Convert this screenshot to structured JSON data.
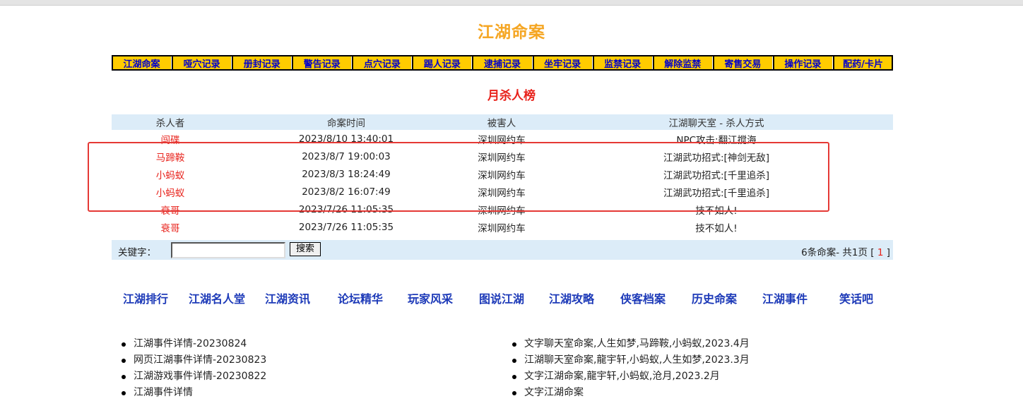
{
  "page": {
    "title": "江湖命案"
  },
  "nav": {
    "items": [
      "江湖命案",
      "哑穴记录",
      "册封记录",
      "警告记录",
      "点穴记录",
      "踢人记录",
      "逮捕记录",
      "坐牢记录",
      "监禁记录",
      "解除监禁",
      "寄售交易",
      "操作记录",
      "配药/卡片"
    ]
  },
  "section": {
    "title": "月杀人榜"
  },
  "table": {
    "headers": [
      "杀人者",
      "命案时间",
      "被害人",
      "江湖聊天室 - 杀人方式"
    ],
    "rows": [
      [
        "闯碟",
        "2023/8/10 13:40:01",
        "深圳网约车",
        "NPC攻击:翻江搅海"
      ],
      [
        "马蹄鞍",
        "2023/8/7 19:00:03",
        "深圳网约车",
        "江湖武功招式:[神剑无敌]"
      ],
      [
        "小蚂蚁",
        "2023/8/3 18:24:49",
        "深圳网约车",
        "江湖武功招式:[千里追杀]"
      ],
      [
        "小蚂蚁",
        "2023/8/2 16:07:49",
        "深圳网约车",
        "江湖武功招式:[千里追杀]"
      ],
      [
        "衰哥",
        "2023/7/26 11:05:35",
        "深圳网约车",
        "技不如人!"
      ],
      [
        "衰哥",
        "2023/7/26 11:05:35",
        "深圳网约车",
        "技不如人!"
      ]
    ]
  },
  "search": {
    "label": "关键字：",
    "value": "",
    "button_label": "搜索",
    "count_text": "6条命案- 共1页 [ ",
    "current_page": "1",
    "close_bracket": " ]"
  },
  "links": [
    "江湖排行",
    "江湖名人堂",
    "江湖资讯",
    "论坛精华",
    "玩家风采",
    "图说江湖",
    "江湖攻略",
    "侠客档案",
    "历史命案",
    "江湖事件",
    "笑话吧"
  ],
  "news_left": [
    "江湖事件详情-20230824",
    "网页江湖事件详情-20230823",
    "江湖游戏事件详情-20230822",
    "江湖事件详情"
  ],
  "news_right": [
    "文字聊天室命案,人生如梦,马蹄鞍,小蚂蚁,2023.4月",
    "江湖聊天室命案,龍宇轩,小蚂蚁,人生如梦,2023.3月",
    "文字江湖命案,龍宇轩,小蚂蚁,沧月,2023.2月",
    "文字江湖命案"
  ],
  "colors": {
    "accent": "#f5a623",
    "nav_bg": "#ffcc00",
    "nav_text": "#0000cc",
    "red": "#e8221b",
    "table_header_bg": "#dcecf8",
    "link": "#1d3ab8"
  }
}
